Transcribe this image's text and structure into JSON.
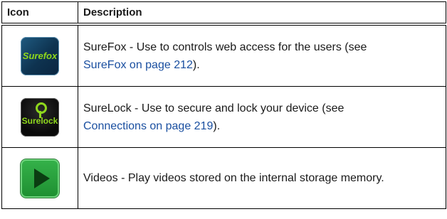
{
  "table": {
    "headers": {
      "icon": "Icon",
      "description": "Description"
    },
    "rows": [
      {
        "icon_name": "surefox-icon",
        "icon_text": "Surefox",
        "desc_prefix": "SureFox - Use to controls web access for the users (see",
        "link_text": "SureFox on page 212",
        "desc_suffix": ")."
      },
      {
        "icon_name": "surelock-icon",
        "icon_text": "Surelock",
        "desc_prefix": "SureLock - Use to secure and lock your device (see",
        "link_text": "Connections on page 219",
        "desc_suffix": ")."
      },
      {
        "icon_name": "videos-play-icon",
        "desc_prefix": "Videos - Play videos stored on the internal storage memory."
      }
    ]
  }
}
